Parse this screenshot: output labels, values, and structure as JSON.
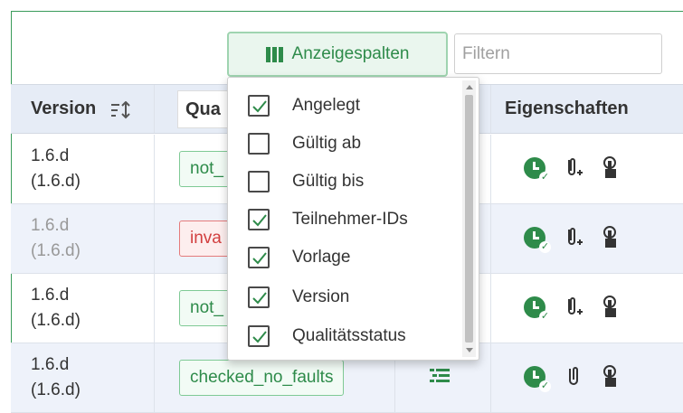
{
  "toolbar": {
    "columns_button_label": "Anzeigespalten",
    "filter_placeholder": "Filtern"
  },
  "table": {
    "headers": {
      "version": "Version",
      "quality_partial": "Qua",
      "properties": "Eigenschaften"
    },
    "rows": [
      {
        "version": "1.6.d",
        "version_paren": "(1.6.d)",
        "status": "not_",
        "status_kind": "ok",
        "muted": false
      },
      {
        "version": "1.6.d",
        "version_paren": "(1.6.d)",
        "status": "inva",
        "status_kind": "bad",
        "muted": true
      },
      {
        "version": "1.6.d",
        "version_paren": "(1.6.d)",
        "status": "not_",
        "status_kind": "ok",
        "muted": false
      },
      {
        "version": "1.6.d",
        "version_paren": "(1.6.d)",
        "status": "checked_no_faults",
        "status_kind": "ok",
        "muted": false
      }
    ]
  },
  "column_menu": {
    "options": [
      {
        "label": "Angelegt",
        "checked": true
      },
      {
        "label": "Gültig ab",
        "checked": false
      },
      {
        "label": "Gültig bis",
        "checked": false
      },
      {
        "label": "Teilnehmer-IDs",
        "checked": true
      },
      {
        "label": "Vorlage",
        "checked": true
      },
      {
        "label": "Version",
        "checked": true
      },
      {
        "label": "Qualitätsstatus",
        "checked": true
      }
    ]
  },
  "colors": {
    "accent_green": "#2e8b4a",
    "error_red": "#d23f3f",
    "header_bg": "#e6ecf6"
  },
  "icons": [
    "columns-icon",
    "sort-icon",
    "history-clock-check-icon",
    "attachment-add-icon",
    "attachment-icon",
    "touch-hand-icon",
    "details-list-icon",
    "checkbox-checked-icon",
    "checkbox-empty-icon"
  ]
}
